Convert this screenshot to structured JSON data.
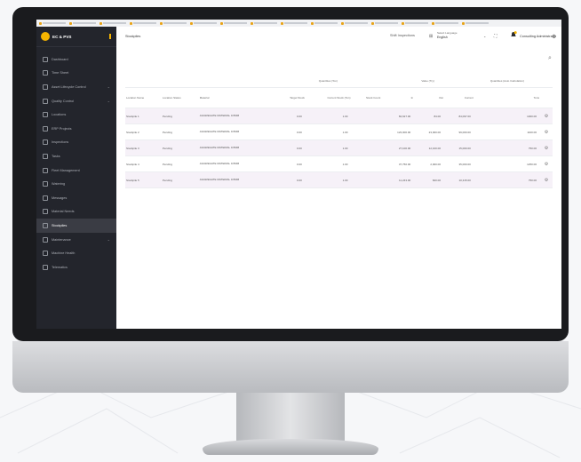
{
  "browser": {
    "bookmarks": [
      "",
      "",
      "",
      "",
      "",
      "",
      "",
      "",
      "",
      "",
      "",
      "",
      "",
      "",
      ""
    ]
  },
  "sidebar": {
    "brand": "EC & PVS",
    "items": [
      {
        "label": "Dashboard",
        "caret": false,
        "active": false
      },
      {
        "label": "Time Sheet",
        "caret": false,
        "active": false
      },
      {
        "label": "Asset Lifecycle Control",
        "caret": true,
        "active": false
      },
      {
        "label": "Quality Control",
        "caret": true,
        "active": false
      },
      {
        "label": "Locations",
        "caret": false,
        "active": false
      },
      {
        "label": "ERP Projects",
        "caret": false,
        "active": false
      },
      {
        "label": "Inspections",
        "caret": false,
        "active": false
      },
      {
        "label": "Tasks",
        "caret": false,
        "active": false
      },
      {
        "label": "Fleet Management",
        "caret": false,
        "active": false
      },
      {
        "label": "Watering",
        "caret": false,
        "active": false
      },
      {
        "label": "Messages",
        "caret": false,
        "active": false
      },
      {
        "label": "Material Needs",
        "caret": false,
        "active": false
      },
      {
        "label": "Stockpiles",
        "caret": false,
        "active": true
      },
      {
        "label": "Maintenance",
        "caret": true,
        "active": false
      },
      {
        "label": "Machine Health",
        "caret": false,
        "active": false
      },
      {
        "label": "Telematics",
        "caret": false,
        "active": false
      }
    ]
  },
  "header": {
    "title": "Stockpiles",
    "toolbar_label": "Shift Inspections",
    "lang_label": "Select Language",
    "lang_value": "English",
    "user": "Consulting Administrator"
  },
  "table": {
    "group_headers": [
      "Quantities (Ton)",
      "Value (Try)",
      "Quantities (Auto Calculation)"
    ],
    "columns": [
      "Location Name",
      "Location Status",
      "Material",
      "Target Stock",
      "Current Stock (Ton)",
      "Stock Count",
      "In",
      "Out",
      "Current",
      "Tons"
    ],
    "rows": [
      {
        "location": "Stockpile 1",
        "status": "Pending",
        "material": "AGGREGATE MATERIAL 0-5MM",
        "target": "0.00",
        "current": "1.00",
        "count": "",
        "in": "84,627.00",
        "out": "84.00",
        "cur": "84,097.00",
        "tons": "1000.00"
      },
      {
        "location": "Stockpile 2",
        "status": "Pending",
        "material": "AGGREGATE MATERIAL 0-5MM",
        "target": "0.00",
        "current": "1.00",
        "count": "",
        "in": "123,000.00",
        "out": "23,000.00",
        "cur": "99,000.00",
        "tons": "1100.00"
      },
      {
        "location": "Stockpile 3",
        "status": "Pending",
        "material": "AGGREGATE MATERIAL 0-5MM",
        "target": "0.00",
        "current": "1.00",
        "count": "",
        "in": "27,100.00",
        "out": "12,100.00",
        "cur": "15,000.00",
        "tons": "750.00"
      },
      {
        "location": "Stockpile 4",
        "status": "Pending",
        "material": "AGGREGATE MATERIAL 0-5MM",
        "target": "0.00",
        "current": "1.00",
        "count": "",
        "in": "37,750.00",
        "out": "2,000.00",
        "cur": "35,000.00",
        "tons": "1250.00"
      },
      {
        "location": "Stockpile 5",
        "status": "Pending",
        "material": "AGGREGATE MATERIAL 0-5MM",
        "target": "0.00",
        "current": "1.00",
        "count": "",
        "in": "11,243.00",
        "out": "600.00",
        "cur": "10,315.00",
        "tons": "750.00"
      }
    ]
  },
  "colors": {
    "accent": "#f5b400",
    "sidebar": "#23252c",
    "row_highlight": "#f6f1f8"
  }
}
